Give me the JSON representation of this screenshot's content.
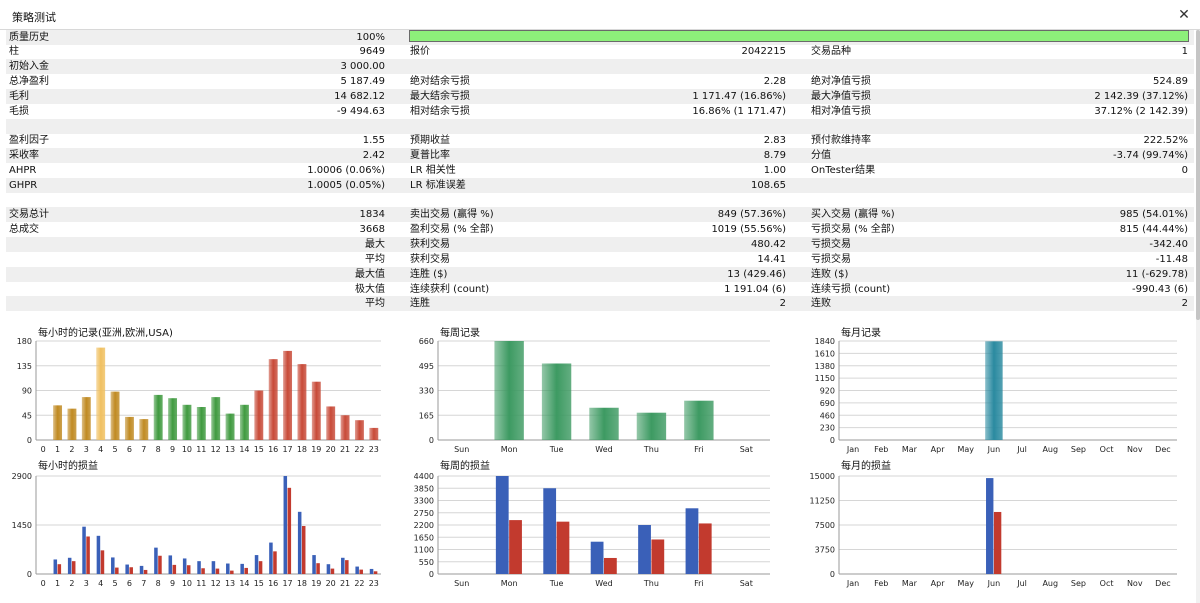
{
  "window": {
    "title": "策略测试"
  },
  "quality": {
    "label": "质量历史",
    "value": "100%",
    "fill_fraction": 1.0,
    "bar_color": "#8df07a"
  },
  "stats": [
    [
      [
        "柱",
        "9649"
      ],
      [
        "报价",
        "2042215"
      ],
      [
        "交易品种",
        "1"
      ]
    ],
    [
      [
        "初始入金",
        "3 000.00"
      ],
      [
        "",
        ""
      ],
      [
        "",
        ""
      ]
    ],
    [
      [
        "总净盈利",
        "5 187.49"
      ],
      [
        "绝对结余亏损",
        "2.28"
      ],
      [
        "绝对净值亏损",
        "524.89"
      ]
    ],
    [
      [
        "毛利",
        "14 682.12"
      ],
      [
        "最大结余亏损",
        "1 171.47 (16.86%)"
      ],
      [
        "最大净值亏损",
        "2 142.39 (37.12%)"
      ]
    ],
    [
      [
        "毛损",
        "-9 494.63"
      ],
      [
        "相对结余亏损",
        "16.86% (1 171.47)"
      ],
      [
        "相对净值亏损",
        "37.12% (2 142.39)"
      ]
    ],
    [
      [
        "",
        ""
      ],
      [
        "",
        ""
      ],
      [
        "",
        ""
      ]
    ],
    [
      [
        "盈利因子",
        "1.55"
      ],
      [
        "预期收益",
        "2.83"
      ],
      [
        "预付款维持率",
        "222.52%"
      ]
    ],
    [
      [
        "采收率",
        "2.42"
      ],
      [
        "夏普比率",
        "8.79"
      ],
      [
        "分值",
        "-3.74 (99.74%)"
      ]
    ],
    [
      [
        "AHPR",
        "1.0006 (0.06%)"
      ],
      [
        "LR 相关性",
        "1.00"
      ],
      [
        "OnTester结果",
        "0"
      ]
    ],
    [
      [
        "GHPR",
        "1.0005 (0.05%)"
      ],
      [
        "LR 标准误差",
        "108.65"
      ],
      [
        "",
        ""
      ]
    ],
    [
      [
        "",
        ""
      ],
      [
        "",
        ""
      ],
      [
        "",
        ""
      ]
    ],
    [
      [
        "交易总计",
        "1834"
      ],
      [
        "卖出交易 (赢得 %)",
        "849 (57.36%)"
      ],
      [
        "买入交易 (赢得 %)",
        "985 (54.01%)"
      ]
    ],
    [
      [
        "总成交",
        "3668"
      ],
      [
        "盈利交易 (% 全部)",
        "1019 (55.56%)"
      ],
      [
        "亏损交易 (% 全部)",
        "815 (44.44%)"
      ]
    ],
    [
      [
        "",
        "最大"
      ],
      [
        "获利交易",
        "480.42"
      ],
      [
        "亏损交易",
        "-342.40"
      ]
    ],
    [
      [
        "",
        "平均"
      ],
      [
        "获利交易",
        "14.41"
      ],
      [
        "亏损交易",
        "-11.48"
      ]
    ],
    [
      [
        "",
        "最大值"
      ],
      [
        "连胜 ($)",
        "13 (429.46)"
      ],
      [
        "连败 ($)",
        "11 (-629.78)"
      ]
    ],
    [
      [
        "",
        "极大值"
      ],
      [
        "连续获利 (count)",
        "1 191.04 (6)"
      ],
      [
        "连续亏损 (count)",
        "-990.43 (6)"
      ]
    ],
    [
      [
        "",
        "平均"
      ],
      [
        "连胜",
        "2"
      ],
      [
        "连败",
        "2"
      ]
    ]
  ],
  "chart_data": [
    {
      "type": "bar",
      "title": "每小时的记录(亚洲,欧洲,USA)",
      "categories": [
        "0",
        "1",
        "2",
        "3",
        "4",
        "5",
        "6",
        "7",
        "8",
        "9",
        "10",
        "11",
        "12",
        "13",
        "14",
        "15",
        "16",
        "17",
        "18",
        "19",
        "20",
        "21",
        "22",
        "23"
      ],
      "values": [
        0,
        63,
        57,
        78,
        168,
        88,
        42,
        38,
        82,
        76,
        64,
        60,
        78,
        48,
        64,
        90,
        147,
        162,
        138,
        106,
        61,
        45,
        36,
        22
      ],
      "colors": [
        "#c08a22",
        "#c08a22",
        "#c08a22",
        "#c08a22",
        "#f0c060",
        "#c08a22",
        "#c08a22",
        "#c08a22",
        "#3f9a3f",
        "#3f9a3f",
        "#3f9a3f",
        "#3f9a3f",
        "#3f9a3f",
        "#3f9a3f",
        "#3f9a3f",
        "#c84a38",
        "#c84a38",
        "#c84a38",
        "#c84a38",
        "#c84a38",
        "#c84a38",
        "#c84a38",
        "#c84a38",
        "#c84a38"
      ],
      "yticks": [
        "0",
        "45",
        "90",
        "135",
        "180"
      ],
      "ylim": [
        0,
        180
      ]
    },
    {
      "type": "bar",
      "title": "每周记录",
      "categories": [
        "Sun",
        "Mon",
        "Tue",
        "Wed",
        "Thu",
        "Fri",
        "Sat"
      ],
      "values": [
        0,
        660,
        510,
        215,
        182,
        262,
        0
      ],
      "colors": [
        "#3d9a62",
        "#3d9a62",
        "#3d9a62",
        "#3d9a62",
        "#3d9a62",
        "#3d9a62",
        "#3d9a62"
      ],
      "yticks": [
        "0",
        "165",
        "330",
        "495",
        "660"
      ],
      "ylim": [
        0,
        660
      ]
    },
    {
      "type": "bar",
      "title": "每月记录",
      "categories": [
        "Jan",
        "Feb",
        "Mar",
        "Apr",
        "May",
        "Jun",
        "Jul",
        "Aug",
        "Sep",
        "Oct",
        "Nov",
        "Dec"
      ],
      "values": [
        0,
        0,
        0,
        0,
        0,
        1834,
        0,
        0,
        0,
        0,
        0,
        0
      ],
      "colors": [
        "#2a8aa0",
        "#2a8aa0",
        "#2a8aa0",
        "#2a8aa0",
        "#2a8aa0",
        "#2a8aa0",
        "#2a8aa0",
        "#2a8aa0",
        "#2a8aa0",
        "#2a8aa0",
        "#2a8aa0",
        "#2a8aa0"
      ],
      "yticks": [
        "0",
        "230",
        "460",
        "690",
        "920",
        "1150",
        "1380",
        "1610",
        "1840"
      ],
      "ylim": [
        0,
        1840
      ]
    },
    {
      "type": "bar",
      "title": "每小时的损益",
      "categories": [
        "0",
        "1",
        "2",
        "3",
        "4",
        "5",
        "6",
        "7",
        "8",
        "9",
        "10",
        "11",
        "12",
        "13",
        "14",
        "15",
        "16",
        "17",
        "18",
        "19",
        "20",
        "21",
        "22",
        "23"
      ],
      "series": [
        {
          "values": [
            0,
            430,
            480,
            1400,
            1130,
            490,
            280,
            240,
            780,
            550,
            460,
            380,
            380,
            310,
            300,
            560,
            930,
            2900,
            1840,
            560,
            290,
            480,
            220,
            150
          ],
          "color": "#3a60b8"
        },
        {
          "values": [
            0,
            290,
            380,
            1110,
            700,
            190,
            200,
            120,
            540,
            270,
            260,
            170,
            160,
            100,
            180,
            380,
            670,
            2550,
            1420,
            320,
            160,
            410,
            130,
            80
          ],
          "color": "#c23a2e"
        }
      ],
      "yticks": [
        "0",
        "1450",
        "2900"
      ],
      "ylim": [
        0,
        2900
      ]
    },
    {
      "type": "bar",
      "title": "每周的损益",
      "categories": [
        "Sun",
        "Mon",
        "Tue",
        "Wed",
        "Thu",
        "Fri",
        "Sat"
      ],
      "series": [
        {
          "values": [
            0,
            4400,
            3850,
            1450,
            2200,
            2950,
            0
          ],
          "color": "#3a60b8"
        },
        {
          "values": [
            0,
            2420,
            2350,
            720,
            1550,
            2270,
            0
          ],
          "color": "#c23a2e"
        }
      ],
      "yticks": [
        "0",
        "550",
        "1100",
        "1650",
        "2200",
        "2750",
        "3300",
        "3850",
        "4400"
      ],
      "ylim": [
        0,
        4400
      ]
    },
    {
      "type": "bar",
      "title": "每月的损益",
      "categories": [
        "Jan",
        "Feb",
        "Mar",
        "Apr",
        "May",
        "Jun",
        "Jul",
        "Aug",
        "Sep",
        "Oct",
        "Nov",
        "Dec"
      ],
      "series": [
        {
          "values": [
            0,
            0,
            0,
            0,
            0,
            14680,
            0,
            0,
            0,
            0,
            0,
            0
          ],
          "color": "#3a60b8"
        },
        {
          "values": [
            0,
            0,
            0,
            0,
            0,
            9495,
            0,
            0,
            0,
            0,
            0,
            0
          ],
          "color": "#c23a2e"
        }
      ],
      "yticks": [
        "0",
        "3750",
        "7500",
        "11250",
        "15000"
      ],
      "ylim": [
        0,
        15000
      ]
    }
  ]
}
